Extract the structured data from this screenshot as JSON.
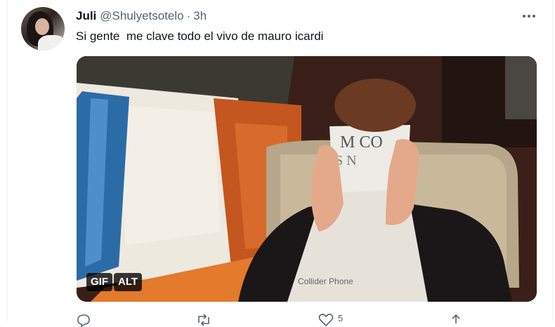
{
  "tweet": {
    "display_name": "Juli",
    "handle": "@Shulyetsotelo",
    "separator": "·",
    "time": "3h",
    "text": "Si gente  me clave todo el vivo de mauro icardi",
    "more_icon": "more-dots-icon"
  },
  "media": {
    "type": "gif",
    "gif_badge": "GIF",
    "alt_badge": "ALT"
  },
  "actions": {
    "items": [
      {
        "name": "reply-icon",
        "count": ""
      },
      {
        "name": "retweet-icon",
        "count": ""
      },
      {
        "name": "like-icon",
        "count": "5"
      },
      {
        "name": "share-icon",
        "count": ""
      }
    ]
  },
  "colors": {
    "text": "#0f1419",
    "secondary": "#536471",
    "border": "#eff3f4"
  }
}
